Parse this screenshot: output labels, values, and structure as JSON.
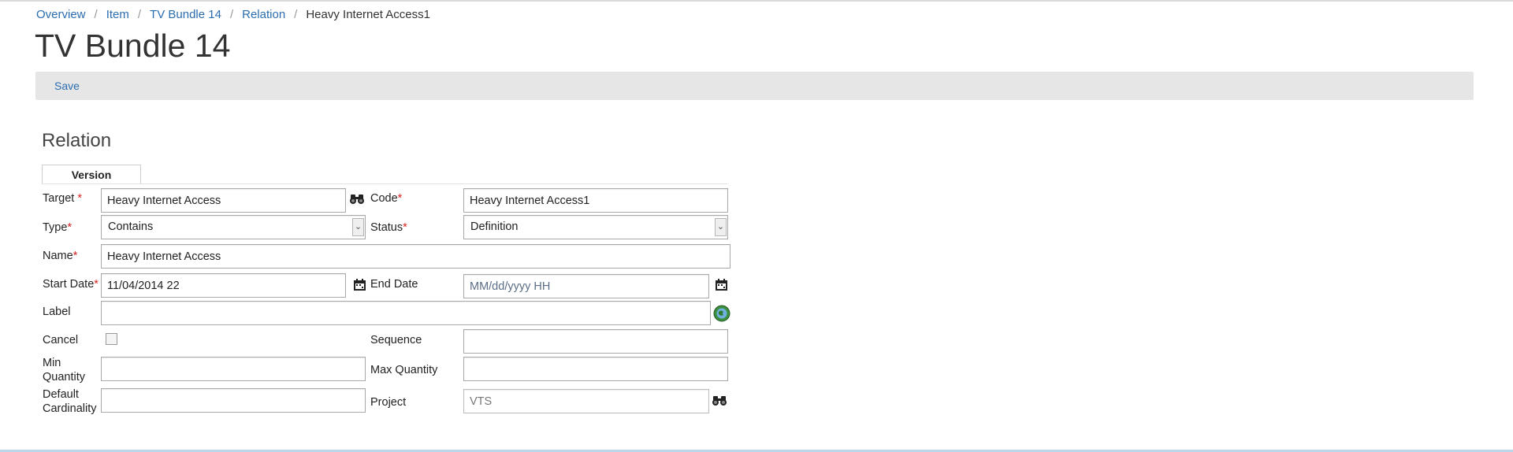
{
  "breadcrumb": {
    "items": [
      "Overview",
      "Item",
      "TV Bundle 14",
      "Relation"
    ],
    "current": "Heavy Internet Access1",
    "separator": "/"
  },
  "page": {
    "title": "TV Bundle 14"
  },
  "toolbar": {
    "save_label": "Save"
  },
  "section": {
    "title": "Relation"
  },
  "tabs": {
    "version": "Version"
  },
  "form": {
    "required_mark": "*",
    "target": {
      "label": "Target",
      "value": "Heavy Internet Access"
    },
    "code": {
      "label": "Code",
      "value": "Heavy Internet Access1"
    },
    "type": {
      "label": "Type",
      "value": "Contains"
    },
    "status": {
      "label": "Status",
      "value": "Definition"
    },
    "name": {
      "label": "Name",
      "value": "Heavy Internet Access"
    },
    "start_date": {
      "label": "Start Date",
      "value": "11/04/2014 22"
    },
    "end_date": {
      "label": "End Date",
      "value": "",
      "placeholder": "MM/dd/yyyy HH"
    },
    "label": {
      "label": "Label",
      "value": ""
    },
    "cancel": {
      "label": "Cancel",
      "checked": false
    },
    "sequence": {
      "label": "Sequence",
      "value": ""
    },
    "min_quantity": {
      "label_line1": "Min",
      "label_line2": "Quantity",
      "value": ""
    },
    "max_quantity": {
      "label": "Max Quantity",
      "value": ""
    },
    "default_cardinality": {
      "label_line1": "Default",
      "label_line2": "Cardinality",
      "value": ""
    },
    "project": {
      "label": "Project",
      "value": "VTS"
    }
  },
  "icons": {
    "target_lookup": "binoculars-icon",
    "project_lookup": "binoculars-icon",
    "start_date_picker": "calendar-icon",
    "end_date_picker": "calendar-icon",
    "label_translate": "globe-icon"
  },
  "colors": {
    "link": "#2a6db0",
    "required": "#dd2222",
    "toolbar_bg": "#e6e6e6"
  }
}
